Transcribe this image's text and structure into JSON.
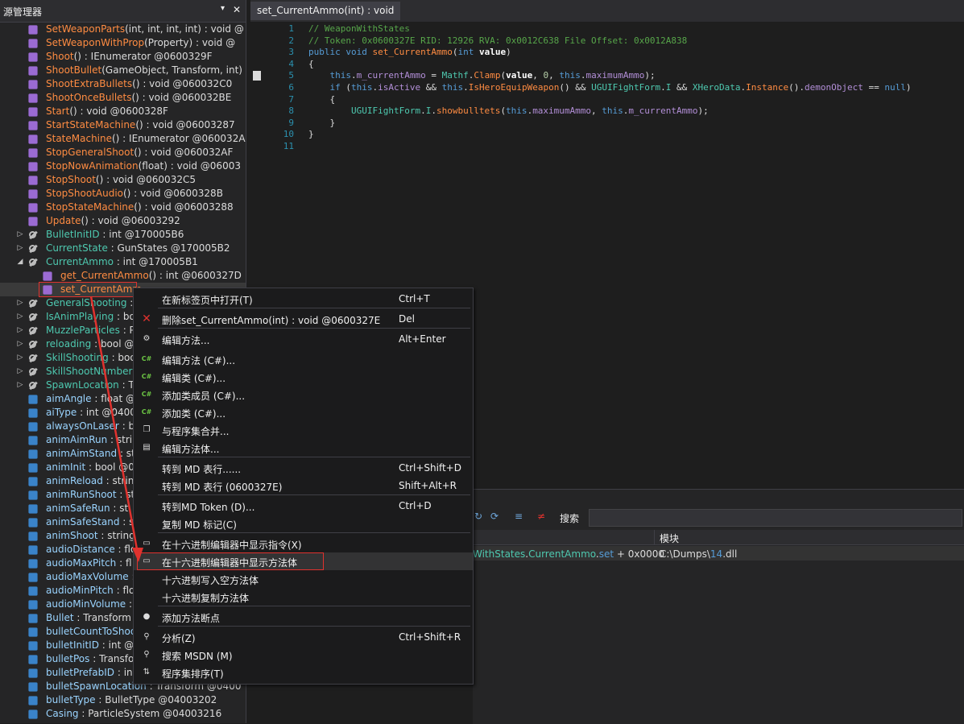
{
  "tree": {
    "title": "源管理器",
    "pin_icon": "pin-icon",
    "close_label": "✕",
    "rows": [
      {
        "name": "SetWeaponParts",
        "sig": "(int, int, int, int) : void @",
        "kind": "method"
      },
      {
        "name": "SetWeaponWithProp",
        "sig": "(Property) : void @",
        "kind": "method"
      },
      {
        "name": "Shoot",
        "sig": "() : IEnumerator @0600329F",
        "kind": "method"
      },
      {
        "name": "ShootBullet",
        "sig": "(GameObject, Transform, int)",
        "kind": "method"
      },
      {
        "name": "ShootExtraBullets",
        "sig": "() : void @060032C0",
        "kind": "method"
      },
      {
        "name": "ShootOnceBullets",
        "sig": "() : void @060032BE",
        "kind": "method"
      },
      {
        "name": "Start",
        "sig": "() : void @0600328F",
        "kind": "method"
      },
      {
        "name": "StartStateMachine",
        "sig": "() : void @06003287",
        "kind": "method"
      },
      {
        "name": "StateMachine",
        "sig": "() : IEnumerator @060032A",
        "kind": "method"
      },
      {
        "name": "StopGeneralShoot",
        "sig": "() : void @060032AF",
        "kind": "method"
      },
      {
        "name": "StopNowAnimation",
        "sig": "(float) : void @06003",
        "kind": "method"
      },
      {
        "name": "StopShoot",
        "sig": "() : void @060032C5",
        "kind": "method"
      },
      {
        "name": "StopShootAudio",
        "sig": "() : void @0600328B",
        "kind": "method"
      },
      {
        "name": "StopStateMachine",
        "sig": "() : void @06003288",
        "kind": "method"
      },
      {
        "name": "Update",
        "sig": "() : void @06003292",
        "kind": "method"
      },
      {
        "name": "BulletInitID",
        "sig": " : int @170005B6",
        "kind": "property"
      },
      {
        "name": "CurrentState",
        "sig": " : GunStates @170005B2",
        "kind": "property"
      },
      {
        "name": "CurrentAmmo",
        "sig": " : int @170005B1",
        "kind": "property"
      },
      {
        "name": "get_CurrentAmmo",
        "sig": "() : int @0600327D",
        "kind": "accessor"
      },
      {
        "name": "set_CurrentAmm",
        "sig": "",
        "kind": "accessor"
      },
      {
        "name": "GeneralShooting",
        "sig": " : ",
        "kind": "property"
      },
      {
        "name": "IsAnimPlaying",
        "sig": " : bo",
        "kind": "property"
      },
      {
        "name": "MuzzleParticles",
        "sig": " : P",
        "kind": "property"
      },
      {
        "name": "reloading",
        "sig": " : bool @",
        "kind": "property"
      },
      {
        "name": "SkillShooting",
        "sig": " : boo",
        "kind": "property"
      },
      {
        "name": "SkillShootNumber",
        "sig": "",
        "kind": "property"
      },
      {
        "name": "SpawnLocation",
        "sig": " : Tr",
        "kind": "property"
      },
      {
        "name": "aimAngle",
        "sig": " : float @",
        "kind": "field"
      },
      {
        "name": "aiType",
        "sig": " : int @0400",
        "kind": "field"
      },
      {
        "name": "alwaysOnLaser",
        "sig": " : bo",
        "kind": "field"
      },
      {
        "name": "animAimRun",
        "sig": " : strin",
        "kind": "field"
      },
      {
        "name": "animAimStand",
        "sig": " : str",
        "kind": "field"
      },
      {
        "name": "animInit",
        "sig": " : bool @0",
        "kind": "field"
      },
      {
        "name": "animReload",
        "sig": " : string",
        "kind": "field"
      },
      {
        "name": "animRunShoot",
        "sig": " : str",
        "kind": "field"
      },
      {
        "name": "animSafeRun",
        "sig": " : st",
        "kind": "field"
      },
      {
        "name": "animSafeStand",
        "sig": " : s",
        "kind": "field"
      },
      {
        "name": "animShoot",
        "sig": " : string",
        "kind": "field"
      },
      {
        "name": "audioDistance",
        "sig": " : flo",
        "kind": "field"
      },
      {
        "name": "audioMaxPitch",
        "sig": " : fl",
        "kind": "field"
      },
      {
        "name": "audioMaxVolume",
        "sig": " : f",
        "kind": "field"
      },
      {
        "name": "audioMinPitch",
        "sig": " : flo",
        "kind": "field"
      },
      {
        "name": "audioMinVolume",
        "sig": " : f",
        "kind": "field"
      },
      {
        "name": "Bullet",
        "sig": " : Transform",
        "kind": "field"
      },
      {
        "name": "bulletCountToShoo",
        "sig": "",
        "kind": "field"
      },
      {
        "name": "bulletInitID",
        "sig": " : int @0",
        "kind": "field"
      },
      {
        "name": "bulletPos",
        "sig": " : Transfo",
        "kind": "field"
      },
      {
        "name": "bulletPrefabID",
        "sig": " : int",
        "kind": "field"
      },
      {
        "name": "bulletSpawnLocation",
        "sig": " : Transform @0400",
        "kind": "field"
      },
      {
        "name": "bulletType",
        "sig": " : BulletType @04003202",
        "kind": "field"
      },
      {
        "name": "Casing",
        "sig": " : ParticleSystem @04003216",
        "kind": "field"
      }
    ]
  },
  "editor": {
    "tab_label": "set_CurrentAmmo(int) : void",
    "close_label": "✕",
    "lines": [
      {
        "n": "1",
        "t": "// WeaponWithStates"
      },
      {
        "n": "2",
        "t": "// Token: 0x0600327E RID: 12926 RVA: 0x0012C638 File Offset: 0x0012A838"
      },
      {
        "n": "3",
        "t": "public void set_CurrentAmmo(int value)"
      },
      {
        "n": "4",
        "t": "{"
      },
      {
        "n": "5",
        "t": "    this.m_currentAmmo = Mathf.Clamp(value, 0, this.maximumAmmo);"
      },
      {
        "n": "6",
        "t": "    if (this.isActive && this.IsHeroEquipWeapon() && UGUIFightForm.I && XHeroData.Instance().demonObject == null)"
      },
      {
        "n": "7",
        "t": "    {"
      },
      {
        "n": "8",
        "t": "        UGUIFightForm.I.showbulltets(this.maximumAmmo, this.m_currentAmmo);"
      },
      {
        "n": "9",
        "t": "    }"
      },
      {
        "n": "10",
        "t": "}"
      },
      {
        "n": "11",
        "t": ""
      }
    ]
  },
  "bottom": {
    "search_label": "搜索",
    "col_module": "模块",
    "row_member": "WithStates.CurrentAmmo.set + 0x0000",
    "row_module": "C:\\Dumps\\14.dll"
  },
  "menu": {
    "items": [
      {
        "label": "在新标签页中打开(T)",
        "shortcut": "Ctrl+T",
        "icon": ""
      },
      {
        "label": "删除set_CurrentAmmo(int) : void @0600327E",
        "shortcut": "Del",
        "icon": "delete-icon"
      },
      {
        "label": "编辑方法...",
        "shortcut": "Alt+Enter",
        "icon": "gear-icon"
      },
      {
        "label": "编辑方法 (C#)...",
        "shortcut": "",
        "icon": "csharp-icon"
      },
      {
        "label": "编辑类 (C#)...",
        "shortcut": "",
        "icon": "csharp-icon"
      },
      {
        "label": "添加类成员 (C#)...",
        "shortcut": "",
        "icon": "csharp-icon"
      },
      {
        "label": "添加类 (C#)...",
        "shortcut": "",
        "icon": "csharp-icon"
      },
      {
        "label": "与程序集合并...",
        "shortcut": "",
        "icon": "merge-icon"
      },
      {
        "label": "编辑方法体...",
        "shortcut": "",
        "icon": "body-icon"
      },
      {
        "label": "转到 MD 表行......",
        "shortcut": "Ctrl+Shift+D",
        "icon": ""
      },
      {
        "label": "转到 MD 表行 (0600327E)",
        "shortcut": "Shift+Alt+R",
        "icon": ""
      },
      {
        "label": "转到MD Token (D)...",
        "shortcut": "Ctrl+D",
        "icon": ""
      },
      {
        "label": "复制 MD 标记(C)",
        "shortcut": "",
        "icon": ""
      },
      {
        "label": "在十六进制编辑器中显示指令(X)",
        "shortcut": "",
        "icon": "hex-icon"
      },
      {
        "label": "在十六进制编辑器中显示方法体",
        "shortcut": "",
        "icon": "hex-icon"
      },
      {
        "label": "十六进制写入空方法体",
        "shortcut": "",
        "icon": ""
      },
      {
        "label": "十六进制复制方法体",
        "shortcut": "",
        "icon": ""
      },
      {
        "label": "添加方法断点",
        "shortcut": "",
        "icon": "breakpoint-icon"
      },
      {
        "label": "分析(Z)",
        "shortcut": "Ctrl+Shift+R",
        "icon": "search-icon"
      },
      {
        "label": "搜索 MSDN (M)",
        "shortcut": "",
        "icon": "search-icon"
      },
      {
        "label": "程序集排序(T)",
        "shortcut": "",
        "icon": "sort-icon"
      }
    ]
  }
}
